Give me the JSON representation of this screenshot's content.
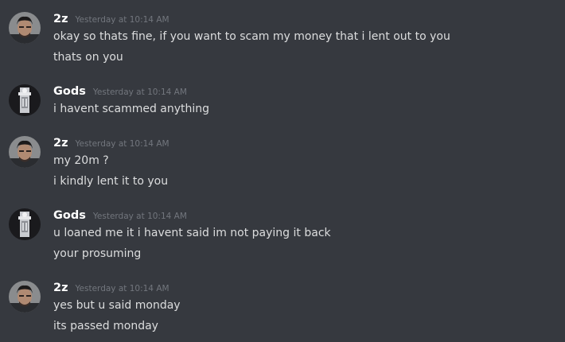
{
  "colors": {
    "background": "#36393f",
    "username": "#ffffff",
    "timestamp": "#72767d",
    "message_text": "#dcddde"
  },
  "messages": [
    {
      "author": "2z",
      "avatar_icon": "user-avatar-man",
      "timestamp": "Yesterday at 10:14 AM",
      "lines": [
        "okay so thats fine, if you want to scam my money that i lent out to you",
        "thats on you"
      ]
    },
    {
      "author": "Gods",
      "avatar_icon": "user-avatar-figure",
      "timestamp": "Yesterday at 10:14 AM",
      "lines": [
        "i havent scammed anything"
      ]
    },
    {
      "author": "2z",
      "avatar_icon": "user-avatar-man",
      "timestamp": "Yesterday at 10:14 AM",
      "lines": [
        "my 20m ?",
        "i kindly lent it to you"
      ]
    },
    {
      "author": "Gods",
      "avatar_icon": "user-avatar-figure",
      "timestamp": "Yesterday at 10:14 AM",
      "lines": [
        "u loaned me it i havent said im not paying it back",
        "your prosuming"
      ]
    },
    {
      "author": "2z",
      "avatar_icon": "user-avatar-man",
      "timestamp": "Yesterday at 10:14 AM",
      "lines": [
        "yes but u said monday",
        "its passed monday"
      ]
    }
  ]
}
